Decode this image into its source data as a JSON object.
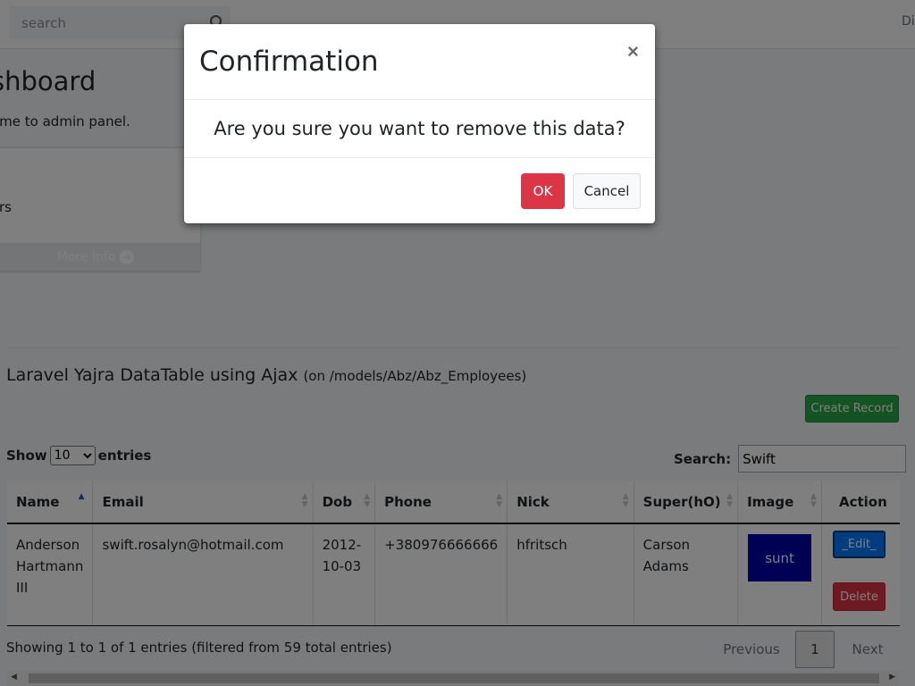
{
  "navbar": {
    "search_placeholder": "search",
    "right_text": "Di"
  },
  "dashboard": {
    "title": "shboard",
    "subtitle": "ome to admin panel.",
    "box_text": "rs",
    "more_info": "More info"
  },
  "table_card": {
    "title": "Laravel Yajra DataTable using Ajax",
    "subtitle": "(on /models/Abz/Abz_Employees)",
    "create_button": "Create Record",
    "show_label": "Show",
    "entries_label": "entries",
    "length_selected": "10",
    "length_options": [
      "10"
    ],
    "search_label": "Search:",
    "search_value": "Swift",
    "columns": [
      "Name",
      "Email",
      "Dob",
      "Phone",
      "Nick",
      "Super(hO)",
      "Image",
      "Action"
    ],
    "rows": [
      {
        "name": "Anderson Hartmann III",
        "email": "swift.rosalyn@hotmail.com",
        "dob": "2012-10-03",
        "phone": "+380976666666",
        "nick": "hfritsch",
        "super": "Carson Adams",
        "image_text": "sunt",
        "edit_label": "_Edit_",
        "delete_label": "Delete"
      }
    ],
    "info": "Showing 1 to 1 of 1 entries (filtered from 59 total entries)",
    "pager": {
      "previous": "Previous",
      "current": "1",
      "next": "Next"
    }
  },
  "modal": {
    "title": "Confirmation",
    "close_symbol": "×",
    "message": "Are you sure you want to remove this data?",
    "ok_label": "OK",
    "cancel_label": "Cancel"
  },
  "colors": {
    "danger": "#dc3545",
    "success": "#28a745",
    "primary": "#007bff",
    "image_placeholder": "#0000a8"
  }
}
